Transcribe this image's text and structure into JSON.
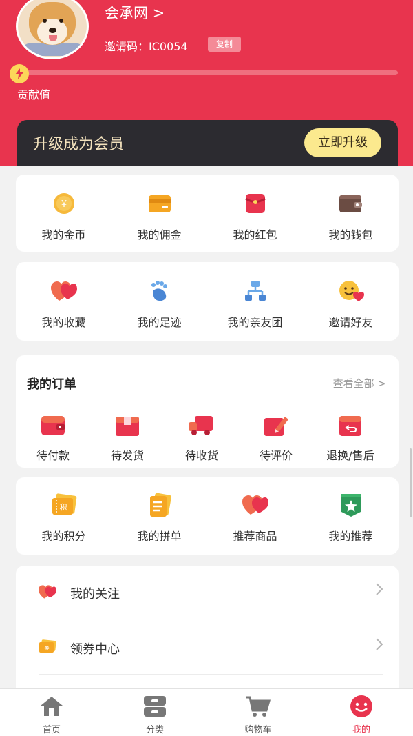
{
  "profile": {
    "username": "会承网 >",
    "invite_label": "邀请码：IC0054",
    "copy_label": "复制",
    "contribution_label": "贡献值",
    "contribution_progress": 0.0
  },
  "membership": {
    "title": "升级成为会员",
    "button_label": "立即升级"
  },
  "assets": [
    {
      "label": "我的金币",
      "icon": "gold-coin-icon"
    },
    {
      "label": "我的佣金",
      "icon": "commission-card-icon"
    },
    {
      "label": "我的红包",
      "icon": "red-packet-icon"
    },
    {
      "label": "我的钱包",
      "icon": "wallet-icon"
    }
  ],
  "activity": [
    {
      "label": "我的收藏",
      "icon": "hearts-icon"
    },
    {
      "label": "我的足迹",
      "icon": "footprint-icon"
    },
    {
      "label": "我的亲友团",
      "icon": "network-icon"
    },
    {
      "label": "邀请好友",
      "icon": "smiley-heart-icon"
    }
  ],
  "orders": {
    "title": "我的订单",
    "see_all": "查看全部 >",
    "items": [
      {
        "label": "待付款",
        "icon": "wallet-pay-icon"
      },
      {
        "label": "待发货",
        "icon": "package-icon"
      },
      {
        "label": "待收货",
        "icon": "delivery-truck-icon"
      },
      {
        "label": "待评价",
        "icon": "pencil-note-icon"
      },
      {
        "label": "退换/售后",
        "icon": "return-box-icon"
      }
    ]
  },
  "more": [
    {
      "label": "我的积分",
      "icon": "points-ticket-icon"
    },
    {
      "label": "我的拼单",
      "icon": "document-stack-icon"
    },
    {
      "label": "推荐商品",
      "icon": "hearts-icon"
    },
    {
      "label": "我的推荐",
      "icon": "star-badge-icon"
    }
  ],
  "list": [
    {
      "label": "我的关注",
      "icon": "hearts-icon"
    },
    {
      "label": "领券中心",
      "icon": "coupon-icon"
    }
  ],
  "tabbar": [
    {
      "label": "首页",
      "icon": "home-icon",
      "active": false
    },
    {
      "label": "分类",
      "icon": "category-icon",
      "active": false
    },
    {
      "label": "购物车",
      "icon": "cart-icon",
      "active": false
    },
    {
      "label": "我的",
      "icon": "smiley-face-icon",
      "active": true
    }
  ],
  "colors": {
    "brand_red": "#e8344e",
    "member_bar": "#2c2b30",
    "upgrade_button": "#fbe98e",
    "accent_orange": "#f5a623"
  }
}
